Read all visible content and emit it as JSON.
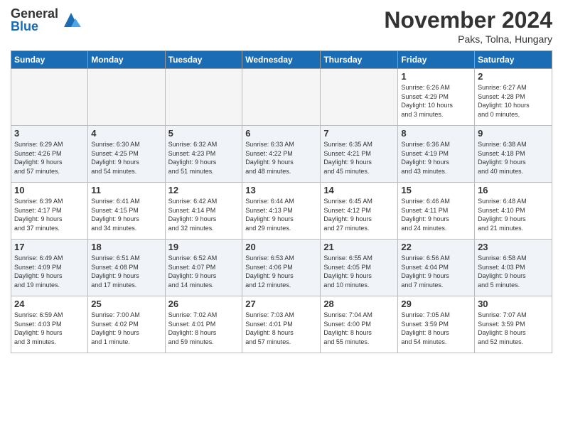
{
  "logo": {
    "general": "General",
    "blue": "Blue"
  },
  "title": "November 2024",
  "location": "Paks, Tolna, Hungary",
  "weekdays": [
    "Sunday",
    "Monday",
    "Tuesday",
    "Wednesday",
    "Thursday",
    "Friday",
    "Saturday"
  ],
  "weeks": [
    [
      {
        "day": "",
        "info": ""
      },
      {
        "day": "",
        "info": ""
      },
      {
        "day": "",
        "info": ""
      },
      {
        "day": "",
        "info": ""
      },
      {
        "day": "",
        "info": ""
      },
      {
        "day": "1",
        "info": "Sunrise: 6:26 AM\nSunset: 4:29 PM\nDaylight: 10 hours\nand 3 minutes."
      },
      {
        "day": "2",
        "info": "Sunrise: 6:27 AM\nSunset: 4:28 PM\nDaylight: 10 hours\nand 0 minutes."
      }
    ],
    [
      {
        "day": "3",
        "info": "Sunrise: 6:29 AM\nSunset: 4:26 PM\nDaylight: 9 hours\nand 57 minutes."
      },
      {
        "day": "4",
        "info": "Sunrise: 6:30 AM\nSunset: 4:25 PM\nDaylight: 9 hours\nand 54 minutes."
      },
      {
        "day": "5",
        "info": "Sunrise: 6:32 AM\nSunset: 4:23 PM\nDaylight: 9 hours\nand 51 minutes."
      },
      {
        "day": "6",
        "info": "Sunrise: 6:33 AM\nSunset: 4:22 PM\nDaylight: 9 hours\nand 48 minutes."
      },
      {
        "day": "7",
        "info": "Sunrise: 6:35 AM\nSunset: 4:21 PM\nDaylight: 9 hours\nand 45 minutes."
      },
      {
        "day": "8",
        "info": "Sunrise: 6:36 AM\nSunset: 4:19 PM\nDaylight: 9 hours\nand 43 minutes."
      },
      {
        "day": "9",
        "info": "Sunrise: 6:38 AM\nSunset: 4:18 PM\nDaylight: 9 hours\nand 40 minutes."
      }
    ],
    [
      {
        "day": "10",
        "info": "Sunrise: 6:39 AM\nSunset: 4:17 PM\nDaylight: 9 hours\nand 37 minutes."
      },
      {
        "day": "11",
        "info": "Sunrise: 6:41 AM\nSunset: 4:15 PM\nDaylight: 9 hours\nand 34 minutes."
      },
      {
        "day": "12",
        "info": "Sunrise: 6:42 AM\nSunset: 4:14 PM\nDaylight: 9 hours\nand 32 minutes."
      },
      {
        "day": "13",
        "info": "Sunrise: 6:44 AM\nSunset: 4:13 PM\nDaylight: 9 hours\nand 29 minutes."
      },
      {
        "day": "14",
        "info": "Sunrise: 6:45 AM\nSunset: 4:12 PM\nDaylight: 9 hours\nand 27 minutes."
      },
      {
        "day": "15",
        "info": "Sunrise: 6:46 AM\nSunset: 4:11 PM\nDaylight: 9 hours\nand 24 minutes."
      },
      {
        "day": "16",
        "info": "Sunrise: 6:48 AM\nSunset: 4:10 PM\nDaylight: 9 hours\nand 21 minutes."
      }
    ],
    [
      {
        "day": "17",
        "info": "Sunrise: 6:49 AM\nSunset: 4:09 PM\nDaylight: 9 hours\nand 19 minutes."
      },
      {
        "day": "18",
        "info": "Sunrise: 6:51 AM\nSunset: 4:08 PM\nDaylight: 9 hours\nand 17 minutes."
      },
      {
        "day": "19",
        "info": "Sunrise: 6:52 AM\nSunset: 4:07 PM\nDaylight: 9 hours\nand 14 minutes."
      },
      {
        "day": "20",
        "info": "Sunrise: 6:53 AM\nSunset: 4:06 PM\nDaylight: 9 hours\nand 12 minutes."
      },
      {
        "day": "21",
        "info": "Sunrise: 6:55 AM\nSunset: 4:05 PM\nDaylight: 9 hours\nand 10 minutes."
      },
      {
        "day": "22",
        "info": "Sunrise: 6:56 AM\nSunset: 4:04 PM\nDaylight: 9 hours\nand 7 minutes."
      },
      {
        "day": "23",
        "info": "Sunrise: 6:58 AM\nSunset: 4:03 PM\nDaylight: 9 hours\nand 5 minutes."
      }
    ],
    [
      {
        "day": "24",
        "info": "Sunrise: 6:59 AM\nSunset: 4:03 PM\nDaylight: 9 hours\nand 3 minutes."
      },
      {
        "day": "25",
        "info": "Sunrise: 7:00 AM\nSunset: 4:02 PM\nDaylight: 9 hours\nand 1 minute."
      },
      {
        "day": "26",
        "info": "Sunrise: 7:02 AM\nSunset: 4:01 PM\nDaylight: 8 hours\nand 59 minutes."
      },
      {
        "day": "27",
        "info": "Sunrise: 7:03 AM\nSunset: 4:01 PM\nDaylight: 8 hours\nand 57 minutes."
      },
      {
        "day": "28",
        "info": "Sunrise: 7:04 AM\nSunset: 4:00 PM\nDaylight: 8 hours\nand 55 minutes."
      },
      {
        "day": "29",
        "info": "Sunrise: 7:05 AM\nSunset: 3:59 PM\nDaylight: 8 hours\nand 54 minutes."
      },
      {
        "day": "30",
        "info": "Sunrise: 7:07 AM\nSunset: 3:59 PM\nDaylight: 8 hours\nand 52 minutes."
      }
    ]
  ]
}
